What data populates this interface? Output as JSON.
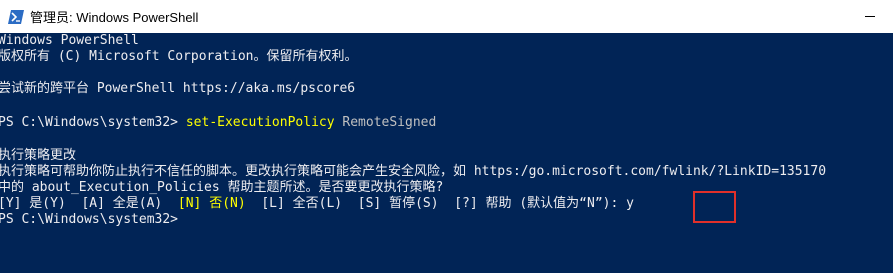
{
  "window": {
    "title": "管理员: Windows PowerShell",
    "icon": "powershell-icon"
  },
  "console": {
    "lines": [
      "Windows PowerShell",
      "版权所有 (C) Microsoft Corporation。保留所有权利。",
      "",
      "尝试新的跨平台 PowerShell https://aka.ms/pscore6",
      "",
      "",
      "",
      "执行策略更改",
      "执行策略可帮助你防止执行不信任的脚本。更改执行策略可能会产生安全风险，如 https:/go.microsoft.com/fwlink/?LinkID=135170",
      "中的 about_Execution_Policies 帮助主题所述。是否要更改执行策略?",
      "",
      "PS C:\\Windows\\system32>"
    ],
    "command_line": {
      "prompt": "PS C:\\Windows\\system32> ",
      "cmdlet": "set-ExecutionPolicy",
      "argument": " RemoteSigned"
    },
    "choice_line": {
      "opt_yes": "[Y] 是(Y)  [A] 全是(A)  ",
      "opt_no": "[N] 否(N)",
      "opt_rest": "  [L] 全否(L)  [S] 暂停(S)  [?] 帮助 (默认值为“N”): y"
    }
  },
  "colors": {
    "background": "#012456",
    "text": "#eeedf0",
    "command": "#ffff00",
    "highlight_border": "#e0302a"
  }
}
